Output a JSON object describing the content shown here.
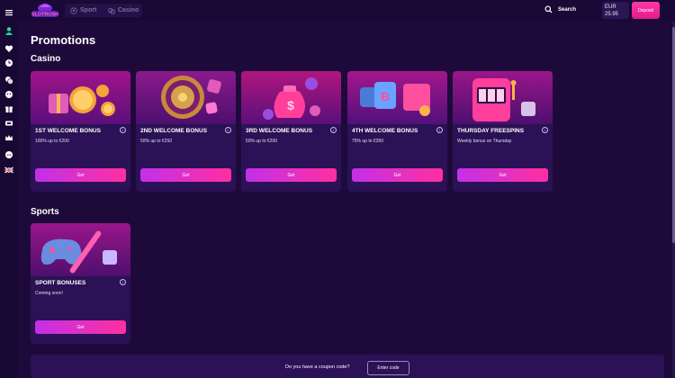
{
  "header": {
    "logo_text": "SLOTRUSH",
    "tabs": [
      {
        "label": "Sport",
        "icon": "soccer-ball-icon"
      },
      {
        "label": "Casino",
        "icon": "dice-icon"
      }
    ],
    "search_label": "Search",
    "balance": {
      "currency": "EUR",
      "amount": "25.95"
    },
    "deposit_label": "Deposit"
  },
  "sidebar": {
    "icons": [
      "menu-icon",
      "avatar-icon",
      "heart-icon",
      "clock-icon",
      "chips-icon",
      "robot-icon",
      "gift-icon",
      "ticket-icon",
      "crown-icon",
      "chat-icon",
      "uk-flag-icon"
    ]
  },
  "page": {
    "title": "Promotions",
    "casino_heading": "Casino",
    "sports_heading": "Sports"
  },
  "casino_cards": [
    {
      "title": "1ST WELCOME BONUS",
      "subtitle": "100% up to €200",
      "button": "Get",
      "art": "coin-gift-art"
    },
    {
      "title": "2ND WELCOME BONUS",
      "subtitle": "50% up to €250",
      "button": "Get",
      "art": "roulette-art"
    },
    {
      "title": "3RD WELCOME BONUS",
      "subtitle": "50% up to €200",
      "button": "Get",
      "art": "money-bag-art"
    },
    {
      "title": "4TH WELCOME BONUS",
      "subtitle": "75% up to €350",
      "button": "Get",
      "art": "bitcoin-wallet-art"
    },
    {
      "title": "THURSDAY FREESPINS",
      "subtitle": "Weekly bonus on Thursday",
      "button": "Get",
      "art": "slot-machine-art"
    }
  ],
  "sports_cards": [
    {
      "title": "SPORT BONUSES",
      "subtitle": "Coming soon!",
      "button": "Get",
      "art": "gamepad-bat-art"
    }
  ],
  "coupon": {
    "question": "Do you have a coupon code?",
    "button": "Enter code"
  },
  "colors": {
    "background": "#1d0a3b",
    "card": "#2b1155",
    "accent_start": "#c230e8",
    "accent_end": "#ff2fa0"
  }
}
